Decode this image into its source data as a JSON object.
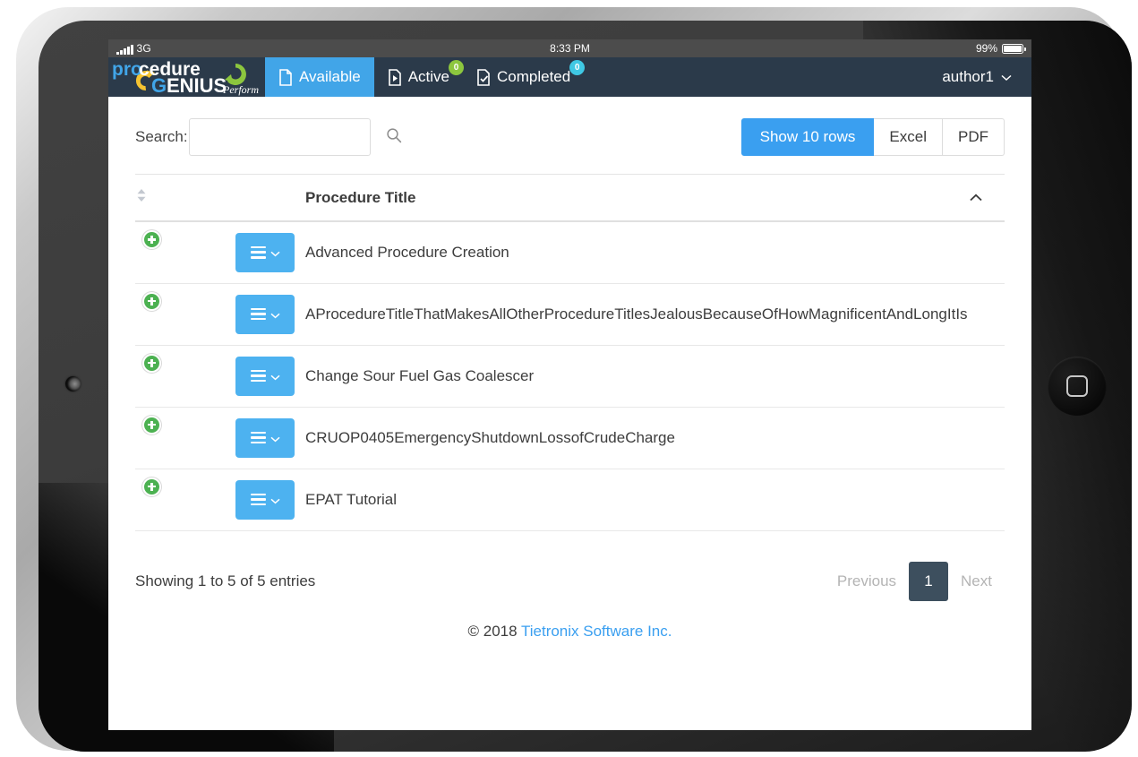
{
  "status_bar": {
    "carrier": "3G",
    "time": "8:33 PM",
    "battery_percent": "99%",
    "signal_icon": "signal-bars-icon",
    "battery_icon": "battery-icon"
  },
  "navbar": {
    "logo_primary": "procedure",
    "logo_secondary": "GENIUS",
    "logo_tagline": "Perform",
    "tabs": [
      {
        "label": "Available",
        "icon": "document-icon",
        "active": true,
        "badge": null,
        "badge_color": null
      },
      {
        "label": "Active",
        "icon": "document-play-icon",
        "active": false,
        "badge": "0",
        "badge_color": "#8cc63e"
      },
      {
        "label": "Completed",
        "icon": "document-check-icon",
        "active": false,
        "badge": "0",
        "badge_color": "#3fc8e4"
      }
    ],
    "user": "author1",
    "user_chevron_icon": "chevron-down-icon"
  },
  "toolbar": {
    "search_label": "Search:",
    "search_value": "",
    "search_placeholder": "",
    "search_icon": "search-icon",
    "buttons": [
      {
        "label": "Show 10 rows",
        "primary": true
      },
      {
        "label": "Excel",
        "primary": false
      },
      {
        "label": "PDF",
        "primary": false
      }
    ]
  },
  "table": {
    "sort_toggle_icon": "sort-updown-icon",
    "header_title": "Procedure Title",
    "sort_caret_icon": "caret-up-icon",
    "row_expand_icon": "plus-circle-icon",
    "row_menu_icon": "hamburger-chevron-icon",
    "rows": [
      {
        "title": "Advanced Procedure Creation"
      },
      {
        "title": "AProcedureTitleThatMakesAllOtherProcedureTitlesJealousBecauseOfHowMagnificentAndLongItIs"
      },
      {
        "title": "Change Sour Fuel Gas Coalescer"
      },
      {
        "title": "CRUOP0405EmergencyShutdownLossofCrudeCharge"
      },
      {
        "title": "EPAT Tutorial"
      }
    ]
  },
  "footer": {
    "entries_info": "Showing 1 to 5 of 5 entries",
    "pagination": {
      "previous": "Previous",
      "current_page": "1",
      "next": "Next"
    },
    "copyright_prefix": "© 2018 ",
    "copyright_link": "Tietronix Software Inc."
  },
  "colors": {
    "navbar_bg": "#2b3a4a",
    "accent_blue": "#3a9ff0",
    "tab_active_blue": "#41a5e8",
    "badge_green": "#8cc63e",
    "badge_cyan": "#3fc8e4",
    "plus_green": "#4cb151",
    "page_active": "#3d4f5e"
  }
}
